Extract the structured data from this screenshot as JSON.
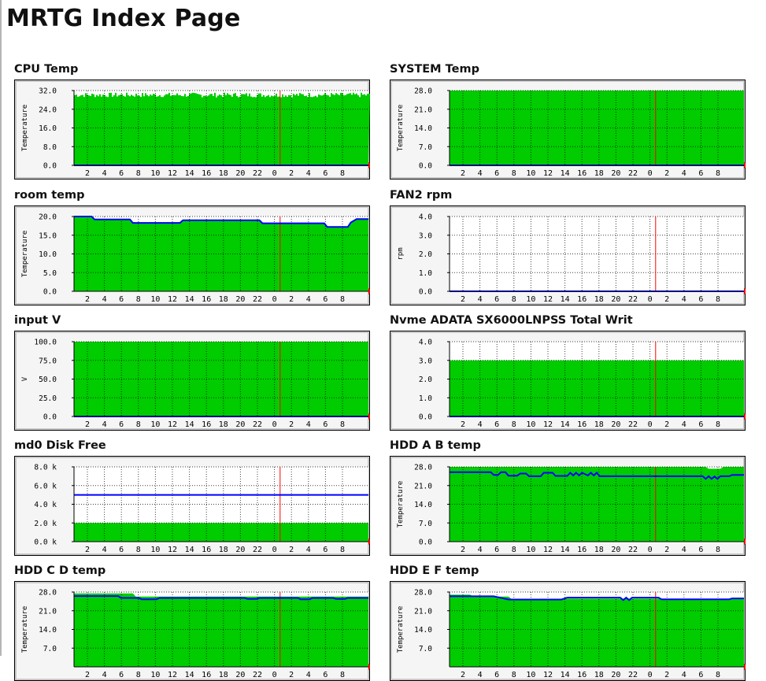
{
  "page": {
    "title": "MRTG Index Page"
  },
  "x_ticks": [
    "2",
    "4",
    "6",
    "8",
    "10",
    "12",
    "14",
    "16",
    "18",
    "20",
    "22",
    "0",
    "2",
    "4",
    "6",
    "8"
  ],
  "colors": {
    "in": "#00cc00",
    "out": "#0000ff",
    "now": "#ff0000",
    "grid": "#000000"
  },
  "panels": [
    {
      "title": "CPU Temp",
      "ylabel": "Temperature",
      "ticks": [
        "32.0",
        "24.0",
        "16.0",
        "8.0",
        "0.0"
      ],
      "ymax": 32,
      "chart_data": {
        "type": "area",
        "in_level": 30.5,
        "in_noise": 2.0,
        "in_ceiling": 32,
        "out_level": 0
      }
    },
    {
      "title": "SYSTEM Temp",
      "ylabel": "Temperature",
      "ticks": [
        "28.0",
        "21.0",
        "14.0",
        "7.0",
        "0.0"
      ],
      "ymax": 28,
      "chart_data": {
        "type": "area",
        "in_level": 28,
        "out_level": 0
      }
    },
    {
      "title": "room temp",
      "ylabel": "Temperature",
      "ticks": [
        "20.0",
        "15.0",
        "10.0",
        "5.0",
        "0.0"
      ],
      "ymax": 20,
      "chart_data": {
        "type": "area",
        "in_profile": [
          [
            0,
            20
          ],
          [
            0.06,
            20
          ],
          [
            0.07,
            19.2
          ],
          [
            0.19,
            19.2
          ],
          [
            0.2,
            18.3
          ],
          [
            0.36,
            18.3
          ],
          [
            0.37,
            19
          ],
          [
            0.63,
            19
          ],
          [
            0.64,
            18.2
          ],
          [
            0.85,
            18.2
          ],
          [
            0.86,
            17.2
          ],
          [
            0.93,
            17.2
          ],
          [
            0.94,
            18.4
          ],
          [
            0.96,
            19.3
          ],
          [
            1,
            19.3
          ]
        ],
        "out_profile": [
          [
            0,
            20
          ],
          [
            0.06,
            20
          ],
          [
            0.07,
            19.2
          ],
          [
            0.19,
            19.2
          ],
          [
            0.2,
            18.3
          ],
          [
            0.36,
            18.3
          ],
          [
            0.37,
            19
          ],
          [
            0.63,
            19
          ],
          [
            0.64,
            18.2
          ],
          [
            0.85,
            18.2
          ],
          [
            0.86,
            17.2
          ],
          [
            0.93,
            17.2
          ],
          [
            0.94,
            18.4
          ],
          [
            0.96,
            19.3
          ],
          [
            1,
            19.3
          ]
        ]
      }
    },
    {
      "title": "FAN2 rpm",
      "ylabel": "rpm",
      "ticks": [
        "4.0",
        "3.0",
        "2.0",
        "1.0",
        "0.0"
      ],
      "ymax": 4,
      "chart_data": {
        "type": "line",
        "in_level": 0,
        "out_level": 0
      }
    },
    {
      "title": "input V",
      "ylabel": "V",
      "ticks": [
        "100.0",
        "75.0",
        "50.0",
        "25.0",
        "0.0"
      ],
      "ymax": 100,
      "chart_data": {
        "type": "area",
        "in_level": 100,
        "out_level": 0
      }
    },
    {
      "title": "Nvme ADATA SX6000LNPSS Total Writ",
      "ylabel": "",
      "ticks": [
        "4.0",
        "3.0",
        "2.0",
        "1.0",
        "0.0"
      ],
      "ymax": 4,
      "chart_data": {
        "type": "area",
        "in_level": 3,
        "out_level": 0
      }
    },
    {
      "title": "md0 Disk Free",
      "ylabel": "",
      "ticks": [
        "8.0 k",
        "6.0 k",
        "4.0 k",
        "2.0 k",
        "0.0 k"
      ],
      "ymax": 8,
      "chart_data": {
        "type": "area",
        "in_level": 2,
        "out_level": 5
      }
    },
    {
      "title": "HDD A B temp",
      "ylabel": "Temperature",
      "ticks": [
        "28.0",
        "21.0",
        "14.0",
        "7.0",
        "0.0"
      ],
      "ymax": 28,
      "chart_data": {
        "type": "area",
        "in_profile": [
          [
            0,
            28
          ],
          [
            0.87,
            28
          ],
          [
            0.88,
            27.3
          ],
          [
            0.92,
            27.3
          ],
          [
            0.93,
            28
          ],
          [
            1,
            28
          ]
        ],
        "out_profile": [
          [
            0,
            26
          ],
          [
            0.14,
            26
          ],
          [
            0.15,
            25
          ],
          [
            0.165,
            25
          ],
          [
            0.175,
            26
          ],
          [
            0.19,
            26
          ],
          [
            0.2,
            24.7
          ],
          [
            0.23,
            24.7
          ],
          [
            0.24,
            25.5
          ],
          [
            0.26,
            25.5
          ],
          [
            0.27,
            24.5
          ],
          [
            0.31,
            24.5
          ],
          [
            0.32,
            25.8
          ],
          [
            0.35,
            25.8
          ],
          [
            0.36,
            24.6
          ],
          [
            0.4,
            24.6
          ],
          [
            0.41,
            25.8
          ],
          [
            0.42,
            24.8
          ],
          [
            0.43,
            25.8
          ],
          [
            0.44,
            24.8
          ],
          [
            0.45,
            25.8
          ],
          [
            0.47,
            24.8
          ],
          [
            0.48,
            25.8
          ],
          [
            0.49,
            24.8
          ],
          [
            0.5,
            25.8
          ],
          [
            0.51,
            24.5
          ],
          [
            0.86,
            24.5
          ],
          [
            0.87,
            23.5
          ],
          [
            0.88,
            24.5
          ],
          [
            0.89,
            23.5
          ],
          [
            0.9,
            24.4
          ],
          [
            0.91,
            23.5
          ],
          [
            0.92,
            24.5
          ],
          [
            0.95,
            24.5
          ],
          [
            0.96,
            25
          ],
          [
            1,
            25
          ]
        ]
      }
    },
    {
      "title": "HDD C D temp",
      "ylabel": "Temperature",
      "ticks": [
        "28.0",
        "21.0",
        "14.0",
        "7.0"
      ],
      "ymax": 28,
      "chart_data": {
        "type": "area",
        "in_profile": [
          [
            0,
            27.5
          ],
          [
            0.2,
            27.5
          ],
          [
            0.21,
            26.3
          ],
          [
            1,
            26.3
          ]
        ],
        "out_profile": [
          [
            0,
            26.5
          ],
          [
            0.15,
            26.5
          ],
          [
            0.16,
            25.8
          ],
          [
            0.22,
            25.8
          ],
          [
            0.23,
            25.3
          ],
          [
            0.28,
            25.3
          ],
          [
            0.29,
            25.8
          ],
          [
            0.58,
            25.8
          ],
          [
            0.59,
            25.4
          ],
          [
            0.62,
            25.4
          ],
          [
            0.63,
            25.8
          ],
          [
            0.76,
            25.8
          ],
          [
            0.77,
            25.3
          ],
          [
            0.8,
            25.3
          ],
          [
            0.81,
            25.8
          ],
          [
            0.88,
            25.8
          ],
          [
            0.89,
            25.4
          ],
          [
            0.92,
            25.4
          ],
          [
            0.93,
            25.8
          ],
          [
            1,
            25.8
          ]
        ]
      }
    },
    {
      "title": "HDD E F temp",
      "ylabel": "Temperature",
      "ticks": [
        "28.0",
        "21.0",
        "14.0",
        "7.0"
      ],
      "ymax": 28,
      "chart_data": {
        "type": "area",
        "in_profile": [
          [
            0,
            27
          ],
          [
            0.07,
            27
          ],
          [
            0.08,
            26.3
          ],
          [
            0.2,
            26.3
          ],
          [
            0.21,
            25.5
          ],
          [
            1,
            25.5
          ]
        ],
        "out_profile": [
          [
            0,
            26.4
          ],
          [
            0.15,
            26.4
          ],
          [
            0.2,
            25.2
          ],
          [
            0.38,
            25.2
          ],
          [
            0.4,
            25.9
          ],
          [
            0.58,
            25.9
          ],
          [
            0.59,
            25
          ],
          [
            0.6,
            25.9
          ],
          [
            0.61,
            25
          ],
          [
            0.62,
            25.9
          ],
          [
            0.71,
            25.9
          ],
          [
            0.72,
            25.3
          ],
          [
            0.95,
            25.3
          ],
          [
            0.96,
            25.6
          ],
          [
            1,
            25.6
          ]
        ]
      }
    }
  ]
}
